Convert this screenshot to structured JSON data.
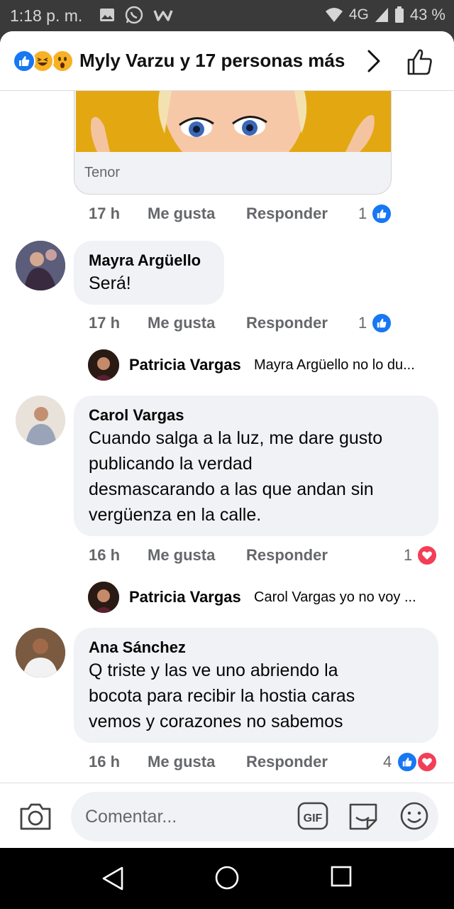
{
  "status_bar": {
    "time": "1:18 p. m.",
    "network": "4G",
    "battery": "43 %",
    "left_icons": [
      "gallery-icon",
      "whatsapp-icon",
      "wattpad-icon"
    ],
    "right_icons": [
      "wifi-icon",
      "signal-icon",
      "battery-icon"
    ]
  },
  "header": {
    "title": "Myly Varzu y 17 personas más",
    "reaction_icons": [
      "like-reaction",
      "haha-reaction",
      "wow-reaction"
    ]
  },
  "gif_card": {
    "source": "Tenor"
  },
  "comments": [
    {
      "time": "17 h",
      "like_label": "Me gusta",
      "reply_label": "Responder",
      "reaction_count": "1",
      "reactions": [
        "like"
      ]
    },
    {
      "author": "Mayra Argüello",
      "text": "Será!",
      "time": "17 h",
      "like_label": "Me gusta",
      "reply_label": "Responder",
      "reaction_count": "1",
      "reactions": [
        "like"
      ],
      "reply": {
        "author": "Patricia Vargas",
        "text": "Mayra Argüello no lo du..."
      }
    },
    {
      "author": "Carol Vargas",
      "text_lines": [
        "Cuando salga a la luz, me dare gusto",
        "publicando la verdad",
        "desmascarando a las que andan sin",
        "vergüenza en la calle."
      ],
      "time": "16 h",
      "like_label": "Me gusta",
      "reply_label": "Responder",
      "reaction_count": "1",
      "reactions": [
        "love"
      ],
      "reply": {
        "author": "Patricia Vargas",
        "text": "Carol Vargas yo no voy ..."
      }
    },
    {
      "author": "Ana Sánchez",
      "text_lines": [
        "Q triste y las ve uno abriendo la",
        "bocota para recibir la hostia caras",
        "vemos y corazones no sabemos"
      ],
      "time": "16 h",
      "like_label": "Me gusta",
      "reply_label": "Responder",
      "reaction_count": "4",
      "reactions": [
        "like",
        "love"
      ]
    }
  ],
  "composer": {
    "placeholder": "Comentar...",
    "gif_label": "GIF"
  },
  "colors": {
    "like_blue": "#1877f2",
    "love_red": "#f33e58",
    "haha_yellow": "#f7b125",
    "bubble_gray": "#f0f2f5",
    "meta_gray": "#65676b"
  }
}
